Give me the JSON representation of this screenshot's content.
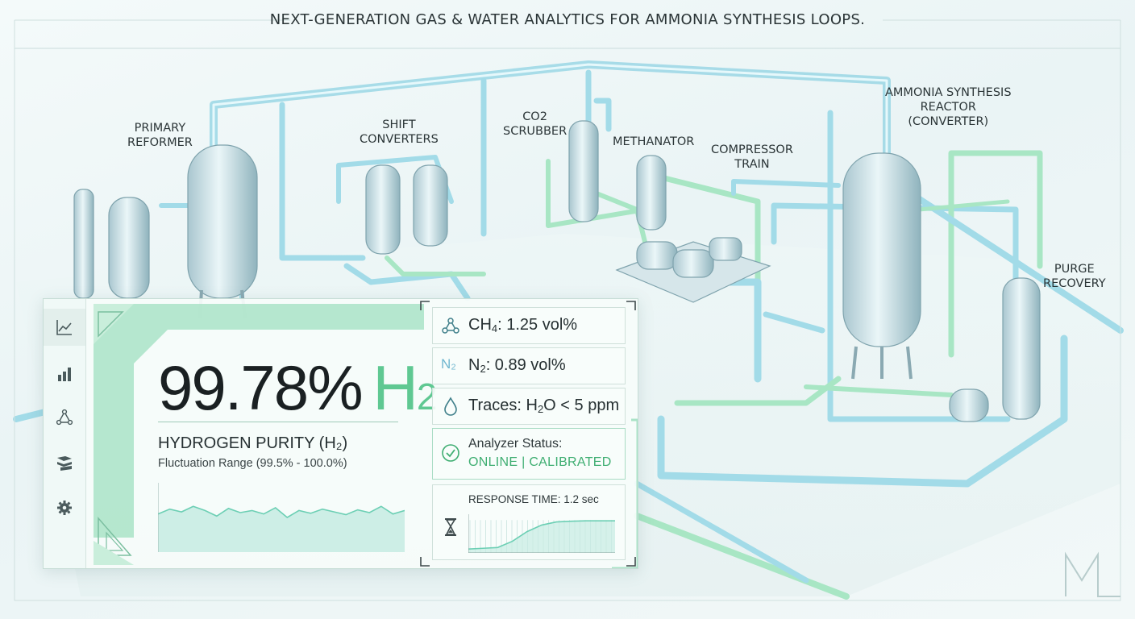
{
  "headline": "NEXT-GENERATION GAS & WATER ANALYTICS FOR AMMONIA SYNTHESIS LOOPS.",
  "plant": {
    "labels": [
      {
        "id": "primary-reformer",
        "lines": [
          "PRIMARY",
          "REFORMER"
        ]
      },
      {
        "id": "shift-converters",
        "lines": [
          "SHIFT",
          "CONVERTERS"
        ]
      },
      {
        "id": "co2-scrubber",
        "lines": [
          "CO2",
          "SCRUBBER"
        ]
      },
      {
        "id": "methanator",
        "lines": [
          "METHANATOR"
        ]
      },
      {
        "id": "compressor-train",
        "lines": [
          "COMPRESSOR",
          "TRAIN"
        ]
      },
      {
        "id": "ammonia-reactor",
        "lines": [
          "AMMONIA SYNTHESIS",
          "REACTOR",
          "(CONVERTER)"
        ]
      },
      {
        "id": "purge-recovery",
        "lines": [
          "PURGE",
          "RECOVERY"
        ]
      }
    ]
  },
  "nav": {
    "items": [
      {
        "id": "trend",
        "icon": "line-chart-icon"
      },
      {
        "id": "bars",
        "icon": "bar-chart-icon"
      },
      {
        "id": "network",
        "icon": "network-icon"
      },
      {
        "id": "layers",
        "icon": "layers-icon"
      },
      {
        "id": "settings",
        "icon": "gear-icon"
      }
    ]
  },
  "purity": {
    "value": "99.78%",
    "species_main": "H",
    "species_sub": "2",
    "title": "HYDROGEN PURITY (H₂)",
    "range": "Fluctuation Range (99.5% - 100.0%)",
    "sparkline": [
      0.55,
      0.62,
      0.58,
      0.66,
      0.6,
      0.52,
      0.63,
      0.57,
      0.6,
      0.55,
      0.64,
      0.5,
      0.6,
      0.56,
      0.62,
      0.58,
      0.54,
      0.61,
      0.57,
      0.66,
      0.55,
      0.6
    ]
  },
  "metrics": {
    "ch4": {
      "species": "CH",
      "sub": "4",
      "value": ": 1.25 vol%"
    },
    "n2": {
      "icon_text": "N₂",
      "species": "N",
      "sub": "2",
      "value": ": 0.89 vol%"
    },
    "traces": {
      "pre": "Traces: H",
      "sub": "2",
      "post": "O < 5 ppm"
    },
    "status": {
      "label": "Analyzer Status:",
      "value": "ONLINE | CALIBRATED"
    },
    "response": {
      "label": "RESPONSE TIME: 1.2 sec",
      "curve": [
        0.1,
        0.12,
        0.14,
        0.3,
        0.55,
        0.72,
        0.8,
        0.82,
        0.83,
        0.83,
        0.83
      ]
    }
  },
  "colors": {
    "accent": "#5fc892",
    "status_ok": "#3fae72",
    "pipe": "#9fd8e6",
    "pipe_green": "#a8e6c4"
  },
  "watermark": "ML"
}
